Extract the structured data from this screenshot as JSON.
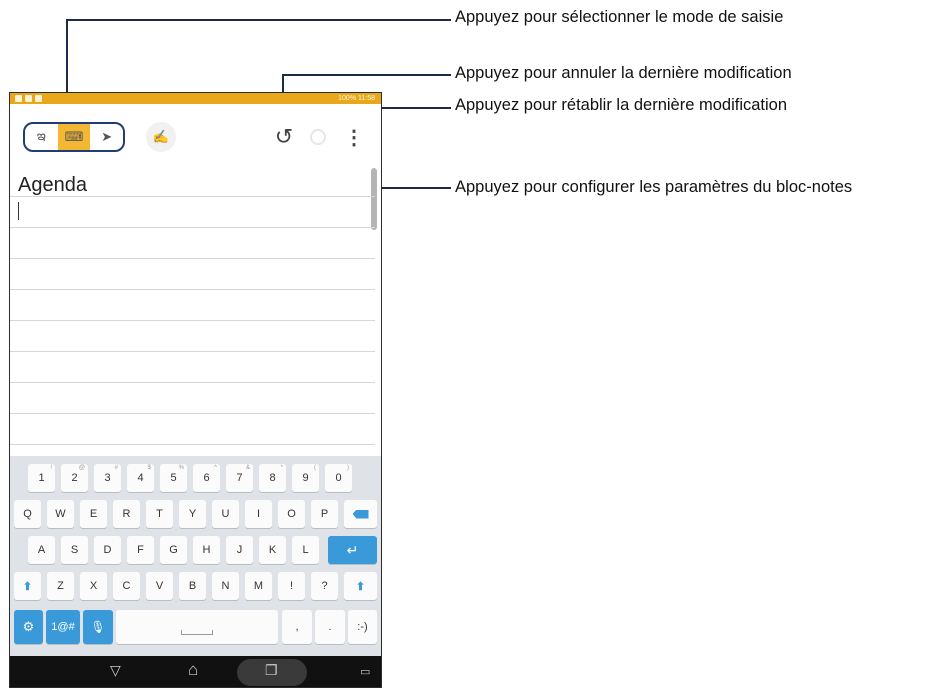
{
  "callouts": {
    "mode": "Appuyez pour sélectionner le mode de saisie",
    "undo": "Appuyez pour annuler la dernière modification",
    "redo": "Appuyez pour rétablir la dernière modification",
    "settings": "Appuyez pour configurer les paramètres du bloc-notes"
  },
  "statusbar": {
    "right_text": "100% 11:58"
  },
  "toolbar": {
    "mode_buttons": [
      {
        "icon": "handwriting-mode-icon",
        "glyph": "ఇ"
      },
      {
        "icon": "keyboard-mode-icon",
        "glyph": "⌨"
      },
      {
        "icon": "draw-mode-icon",
        "glyph": "➤"
      }
    ],
    "pen_glyph": "✍",
    "undo_glyph": "↺",
    "more_glyph": "⋮"
  },
  "note": {
    "title": "Agenda"
  },
  "keyboard": {
    "row_numbers": [
      "1",
      "2",
      "3",
      "4",
      "5",
      "6",
      "7",
      "8",
      "9",
      "0"
    ],
    "row_numbers_sup": [
      "!",
      "@",
      "#",
      "$",
      "%",
      "^",
      "&",
      "*",
      "(",
      ")"
    ],
    "row1": [
      "Q",
      "W",
      "E",
      "R",
      "T",
      "Y",
      "U",
      "I",
      "O",
      "P"
    ],
    "row2": [
      "A",
      "S",
      "D",
      "F",
      "G",
      "H",
      "J",
      "K",
      "L"
    ],
    "row3": [
      "Z",
      "X",
      "C",
      "V",
      "B",
      "N",
      "M",
      "!",
      "?"
    ],
    "sym_label": "1@#",
    "comma": ",",
    "period": ".",
    "smiley": ":-)"
  },
  "navbar": {
    "back": "▽",
    "home": "⌂",
    "recent": "❐",
    "keyboard": "▭"
  },
  "colors": {
    "accent": "#f4b731",
    "callout_line": "#1b2a47",
    "status_bar": "#e9a81b",
    "key_blue": "#3a9ad9"
  }
}
